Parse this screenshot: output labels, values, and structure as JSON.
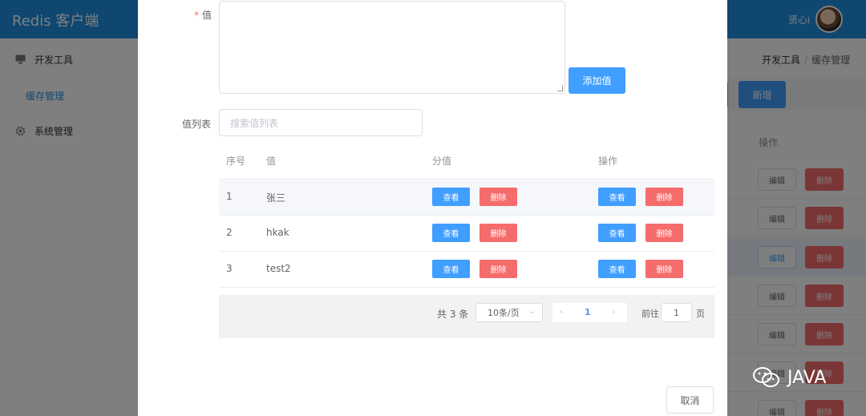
{
  "app": {
    "title": "Redis 客户端",
    "user": "贤心i",
    "sidebar": {
      "items": [
        {
          "label": "开发工具",
          "icon": "monitor-icon"
        },
        {
          "label": "系统管理",
          "icon": "gear-icon"
        }
      ],
      "sub_item": "缓存管理"
    },
    "breadcrumb": {
      "parent": "开发工具",
      "separator": "/",
      "current": "缓存管理"
    },
    "add_button": "新增",
    "ops_header": "操作",
    "row_edit": "编辑",
    "row_delete": "删除"
  },
  "dialog": {
    "value_label": "值",
    "required_mark": "*",
    "add_value_button": "添加值",
    "list_label": "值列表",
    "search_placeholder": "搜索值列表",
    "columns": [
      "序号",
      "值",
      "分值",
      "操作"
    ],
    "rows": [
      {
        "index": "1",
        "value": "张三"
      },
      {
        "index": "2",
        "value": "hkak"
      },
      {
        "index": "3",
        "value": "test2"
      }
    ],
    "view_label": "查看",
    "delete_label": "删除",
    "pagination": {
      "total": "共 3 条",
      "page_size": "10条/页",
      "current_page": "1",
      "goto_label": "前往",
      "goto_value": "1",
      "page_unit": "页"
    },
    "cancel_button": "取消"
  },
  "watermark": "JAVA"
}
